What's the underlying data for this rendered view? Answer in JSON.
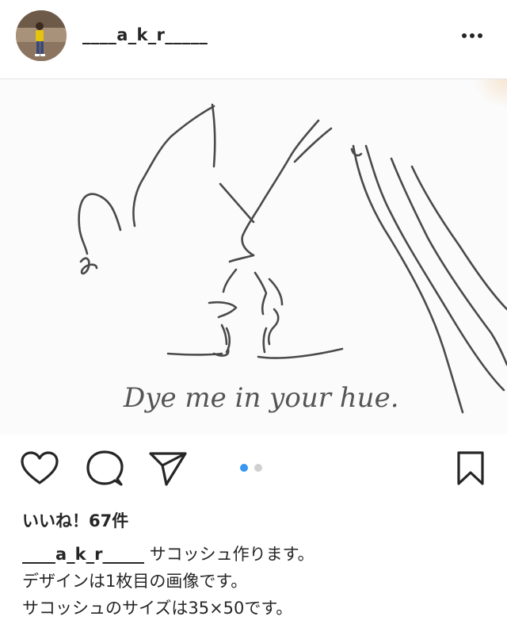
{
  "post": {
    "username": "____a_k_r_____",
    "likes_text": "いいね！67件",
    "caption": {
      "username": "____a_k_r_____",
      "lines": [
        "サコッシュ作ります。",
        "デザインは1枚目の画像です。",
        "サコッシュのサイズは35×50です。"
      ]
    },
    "image_text": "Dye me in your hue.",
    "carousel": {
      "current": 1,
      "total": 2
    }
  },
  "icons": {
    "more": "more-horizontal-icon",
    "like": "heart-icon",
    "comment": "comment-bubble-icon",
    "share": "paper-plane-icon",
    "save": "bookmark-icon"
  },
  "colors": {
    "active_dot": "#3897f0",
    "inactive_dot": "#d0d0d0",
    "text": "#262626",
    "divider": "#e4e4e4"
  }
}
